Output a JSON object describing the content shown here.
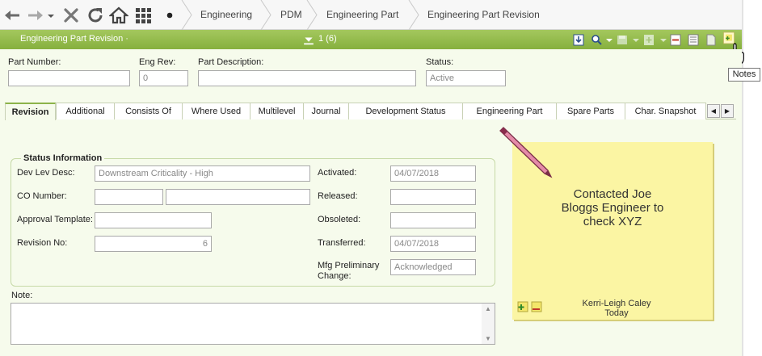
{
  "nav": {
    "icons": [
      "back-arrow-icon",
      "forward-arrow-icon",
      "close-icon",
      "refresh-icon",
      "home-icon",
      "grid-menu-icon",
      "dot-icon"
    ],
    "breadcrumbs": [
      "Engineering",
      "PDM",
      "Engineering Part",
      "Engineering Part Revision"
    ]
  },
  "titlebar": {
    "title": "Engineering Part Revision ·",
    "counter": "1 (6)"
  },
  "header": {
    "part_number_label": "Part Number:",
    "part_number_value": "",
    "eng_rev_label": "Eng Rev:",
    "eng_rev_value": "0",
    "part_desc_label": "Part Description:",
    "part_desc_value": "",
    "status_label": "Status:",
    "status_value": "Active"
  },
  "tabs": [
    "Revision",
    "Additional",
    "Consists Of",
    "Where Used",
    "Multilevel",
    "Journal",
    "Development Status",
    "Engineering Part",
    "Spare Parts",
    "Char. Snapshot"
  ],
  "status_info": {
    "title": "Status Information",
    "dev_lev_desc_label": "Dev Lev Desc:",
    "dev_lev_desc_value": "Downstream Criticality - High",
    "co_number_label": "CO Number:",
    "co_number_value": "",
    "co_number_desc": "",
    "approval_template_label": "Approval Template:",
    "approval_template_value": "",
    "revision_no_label": "Revision No:",
    "revision_no_value": "6",
    "activated_label": "Activated:",
    "activated_value": "04/07/2018",
    "released_label": "Released:",
    "released_value": "",
    "obsoleted_label": "Obsoleted:",
    "obsoleted_value": "",
    "transferred_label": "Transferred:",
    "transferred_value": "04/07/2018",
    "mfg_label_line1": "Mfg Preliminary",
    "mfg_label_line2": "Change:",
    "mfg_value": "Acknowledged"
  },
  "note": {
    "label": "Note:",
    "value": ""
  },
  "sticky": {
    "text": "Contacted Joe\nBloggs Engineer to\ncheck XYZ",
    "author": "Kerri-Leigh Caley",
    "date": "Today"
  },
  "tooltip": "Notes",
  "colors": {
    "accent_green": "#8cb34a",
    "panel_bg": "#f6fbec",
    "sticky_bg": "#fbf5a3"
  }
}
